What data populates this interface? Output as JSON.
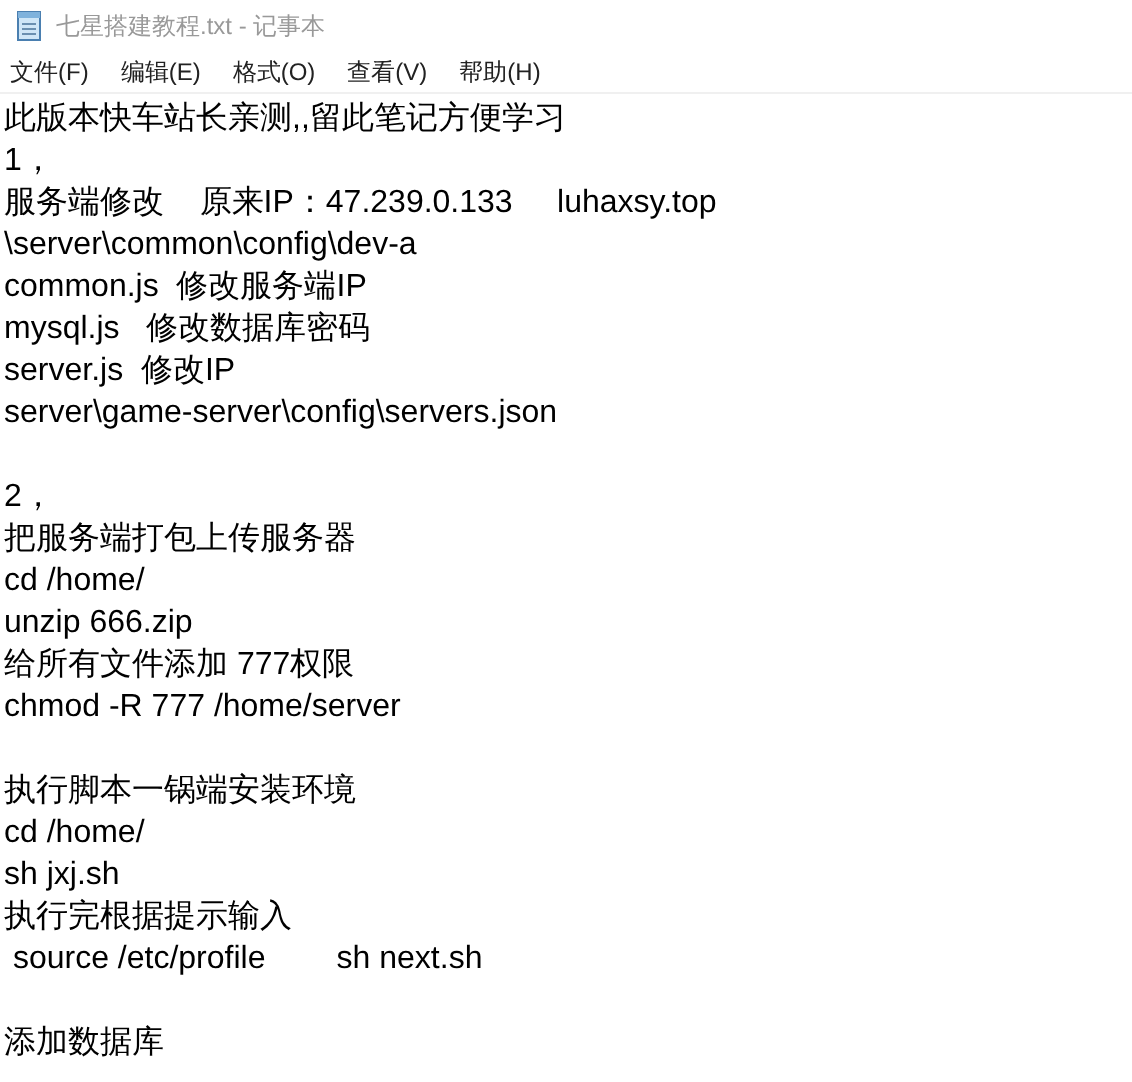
{
  "window": {
    "title": "七星搭建教程.txt - 记事本"
  },
  "menu": [
    "文件(F)",
    "编辑(E)",
    "格式(O)",
    "查看(V)",
    "帮助(H)"
  ],
  "document": {
    "paragraphs": [
      [
        "此版本快车站长亲测,,留此笔记方便学习",
        "1，",
        "服务端修改    原来IP：47.239.0.133     luhaxsy.top",
        "\\server\\common\\config\\dev-a",
        "common.js  修改服务端IP",
        "mysql.js   修改数据库密码",
        "server.js  修改IP",
        "server\\game-server\\config\\servers.json"
      ],
      [
        "2，",
        "把服务端打包上传服务器",
        "cd /home/",
        "unzip 666.zip",
        "给所有文件添加 777权限",
        "chmod -R 777 /home/server"
      ],
      [
        "执行脚本一锅端安装环境",
        "cd /home/",
        "sh jxj.sh",
        "执行完根据提示输入",
        " source /etc/profile        sh next.sh"
      ],
      [
        "添加数据库"
      ]
    ]
  }
}
